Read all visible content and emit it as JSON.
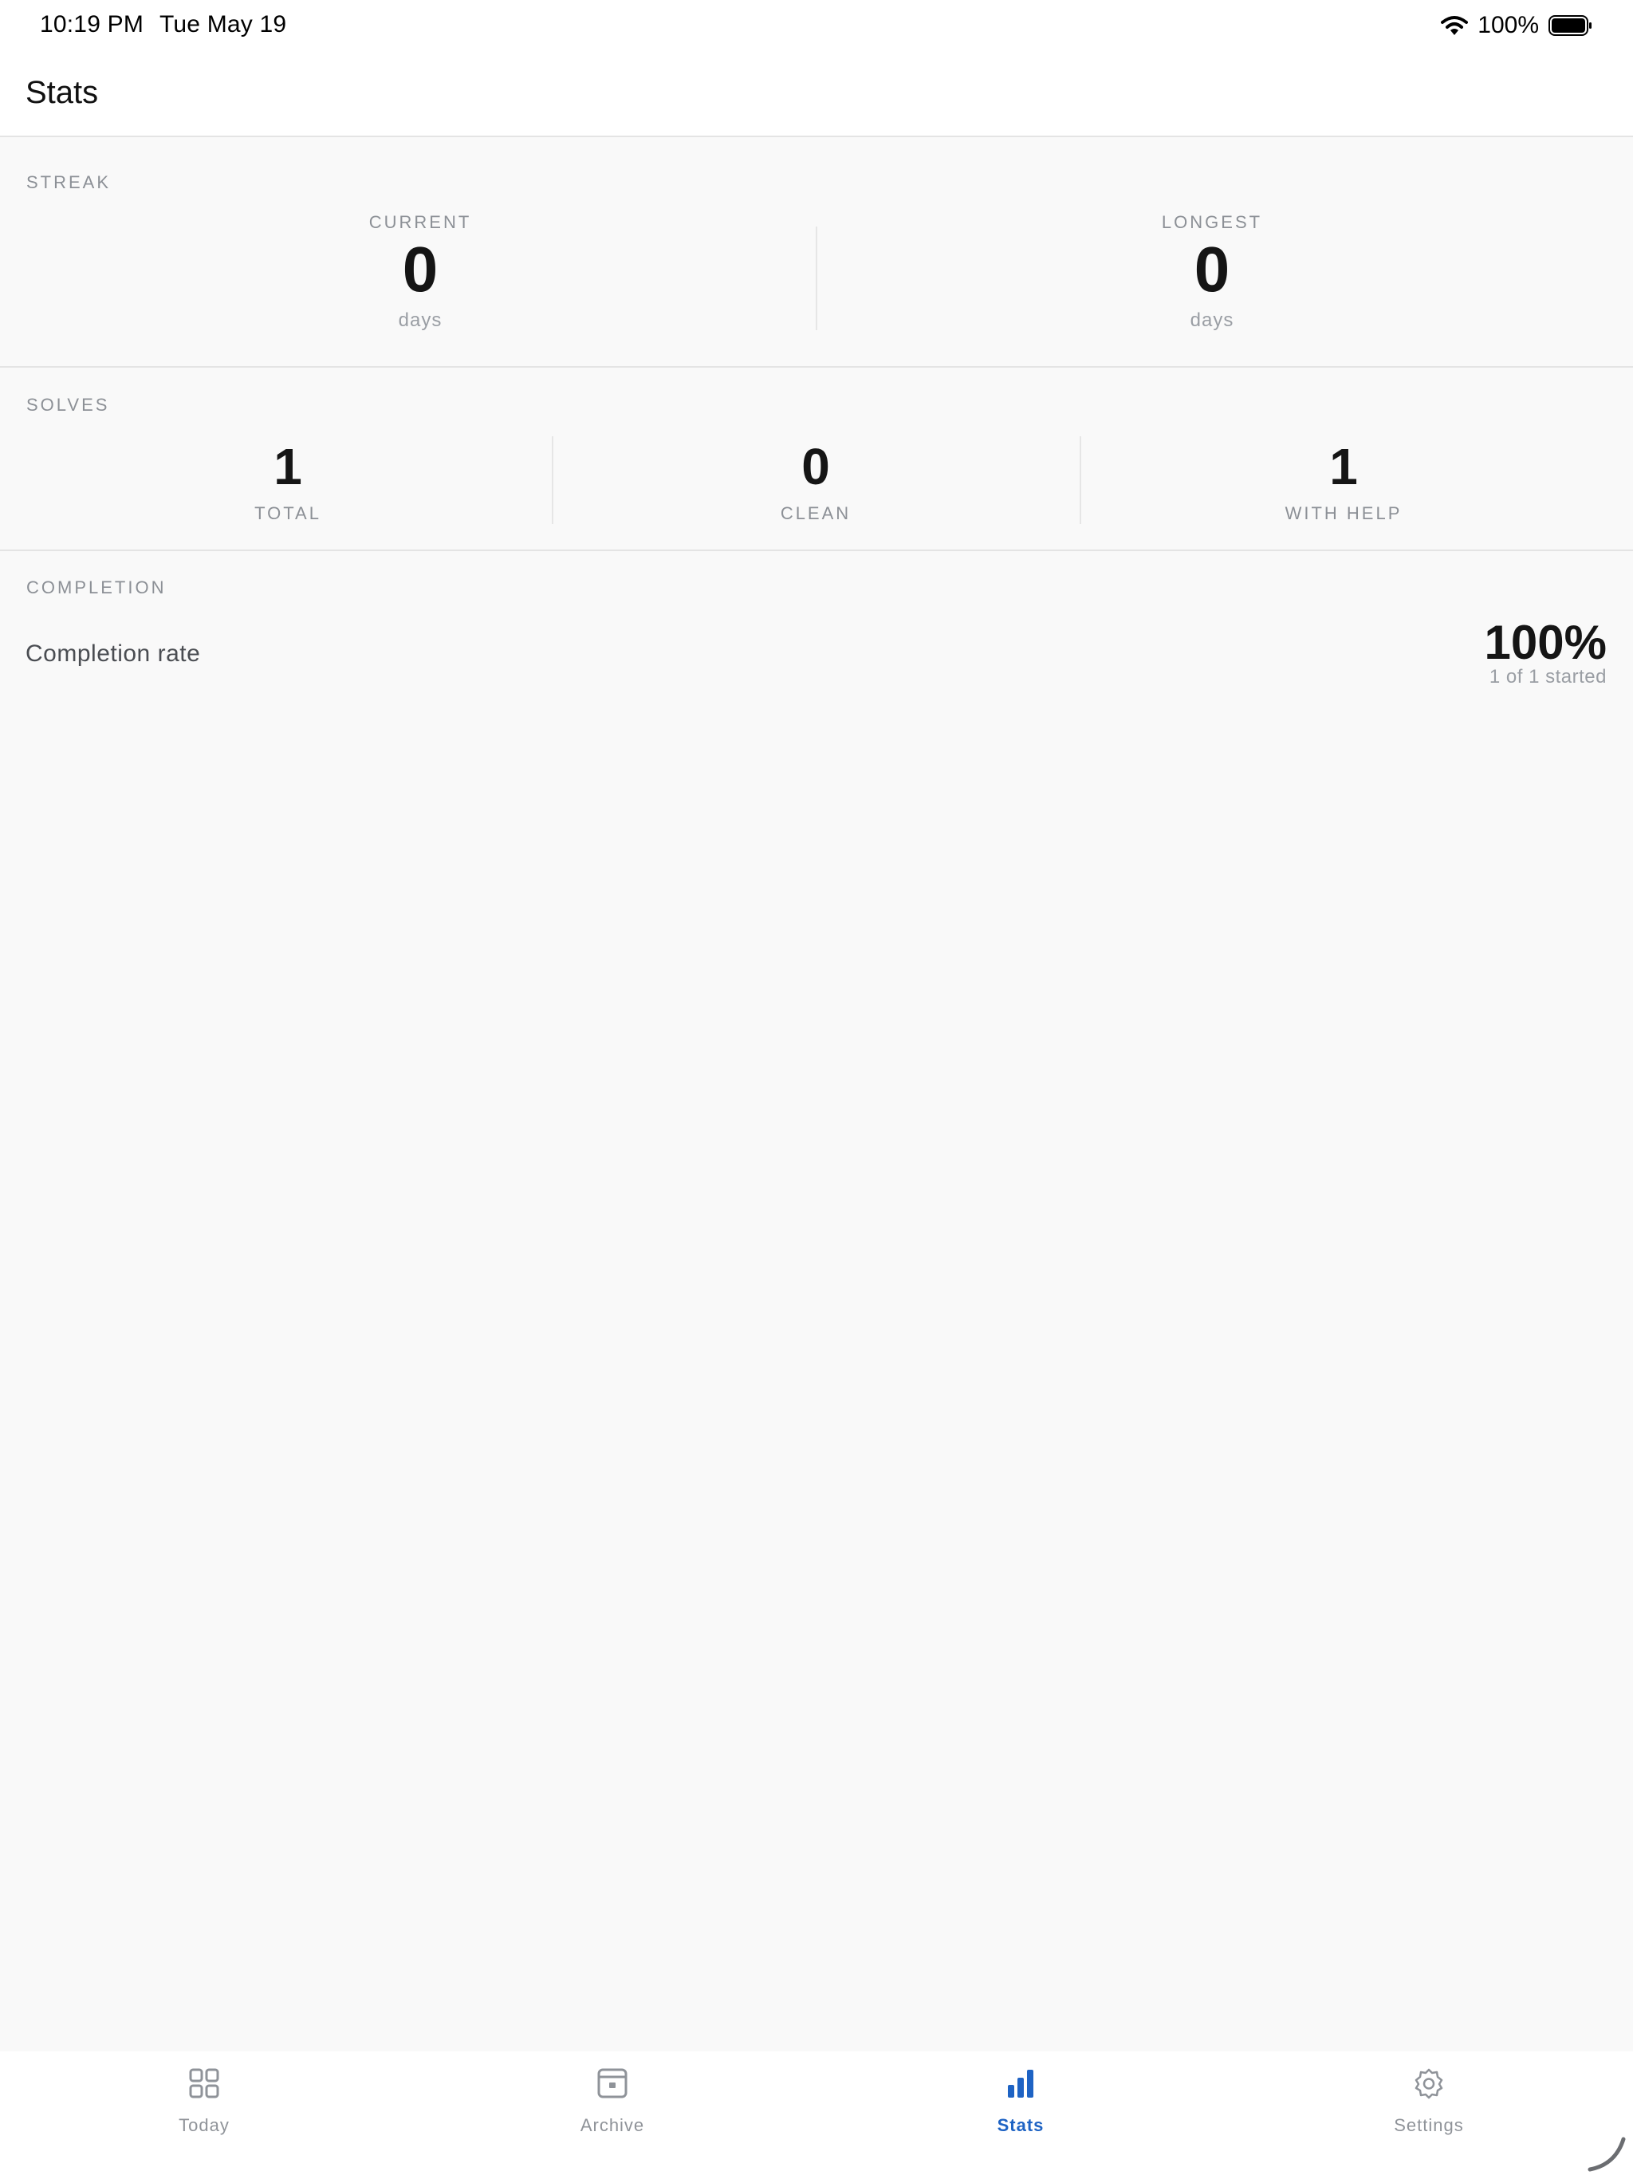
{
  "status_bar": {
    "time": "10:19 PM",
    "date": "Tue May 19",
    "battery": "100%",
    "icons": [
      "wifi-icon",
      "battery-icon"
    ]
  },
  "header": {
    "title": "Stats"
  },
  "streak": {
    "label": "STREAK",
    "current": {
      "label": "CURRENT",
      "value": "0",
      "unit": "days"
    },
    "longest": {
      "label": "LONGEST",
      "value": "0",
      "unit": "days"
    }
  },
  "solves": {
    "label": "SOLVES",
    "items": [
      {
        "value": "1",
        "label": "TOTAL"
      },
      {
        "value": "0",
        "label": "CLEAN"
      },
      {
        "value": "1",
        "label": "WITH HELP"
      }
    ]
  },
  "completion": {
    "label": "COMPLETION",
    "row_label": "Completion rate",
    "value": "100%",
    "detail": "1 of 1 started"
  },
  "tab_bar": {
    "active": "stats",
    "accent_color": "#1e63c4",
    "inactive_color": "#8f9399",
    "tabs": [
      {
        "id": "today",
        "label": "Today",
        "icon": "grid-icon"
      },
      {
        "id": "archive",
        "label": "Archive",
        "icon": "archive-icon"
      },
      {
        "id": "stats",
        "label": "Stats",
        "icon": "bar-chart-icon"
      },
      {
        "id": "settings",
        "label": "Settings",
        "icon": "gear-icon"
      }
    ]
  }
}
